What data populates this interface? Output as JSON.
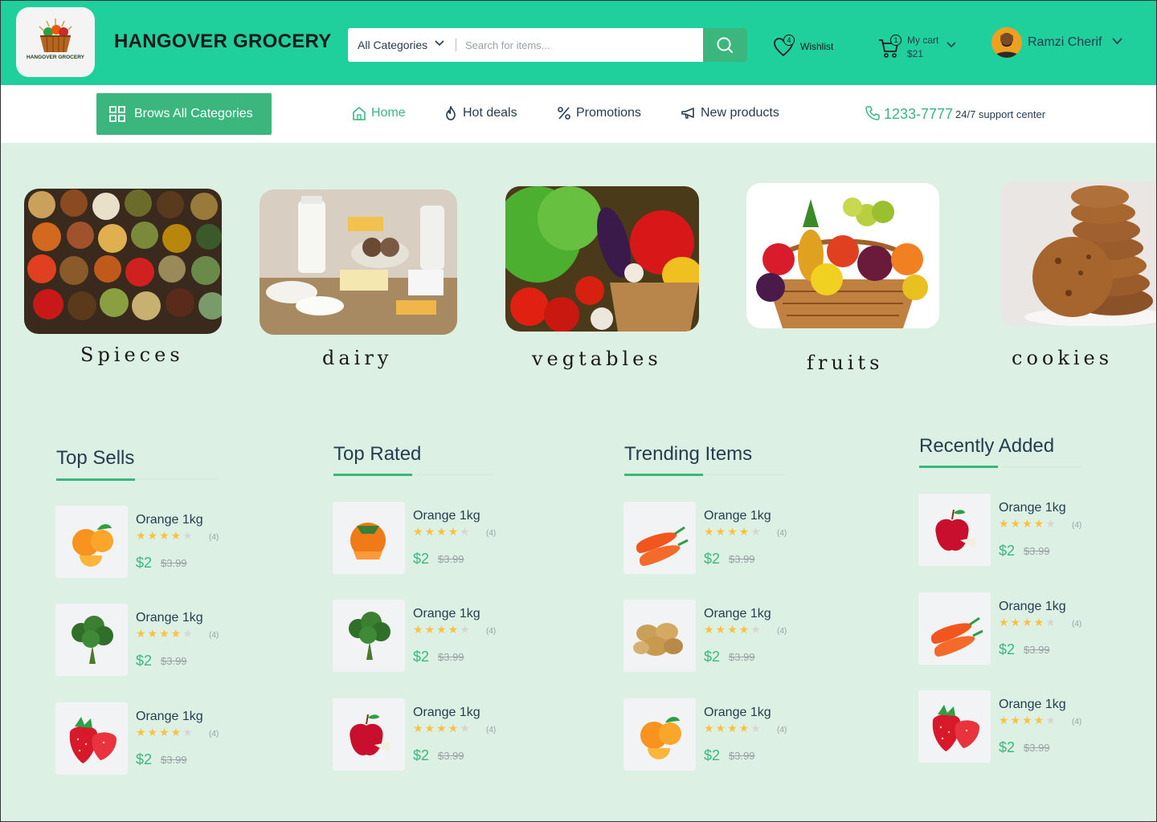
{
  "header": {
    "brand": "HANGOVER GROCERY",
    "logo_text": "HANGOVER GROCERY",
    "search": {
      "category": "All Categories",
      "placeholder": "Search for items..."
    },
    "wishlist": {
      "label": "Wishlist",
      "count": "4"
    },
    "cart": {
      "label": "My cart",
      "total": "$21",
      "count": "1"
    },
    "user": {
      "name": "Ramzi Cherif"
    }
  },
  "nav": {
    "browse_label": "Brows All Categories",
    "items": [
      "Home",
      "Hot deals",
      "Promotions",
      "New products"
    ],
    "phone": "1233-7777",
    "support": "24/7 support center"
  },
  "categories": [
    "Spieces",
    "dairy",
    "vegtables",
    "fruits",
    "cookies"
  ],
  "columns": [
    {
      "title": "Top Sells",
      "products": [
        {
          "image": "orange-icon",
          "name": "Orange 1kg",
          "rating": 4,
          "count": "(4)",
          "price": "$2",
          "old_price": "$3.99"
        },
        {
          "image": "broccoli-icon",
          "name": "Orange 1kg",
          "rating": 4,
          "count": "(4)",
          "price": "$2",
          "old_price": "$3.99"
        },
        {
          "image": "strawberry-icon",
          "name": "Orange 1kg",
          "rating": 4,
          "count": "(4)",
          "price": "$2",
          "old_price": "$3.99"
        }
      ]
    },
    {
      "title": "Top Rated",
      "products": [
        {
          "image": "persimmon-icon",
          "name": "Orange 1kg",
          "rating": 4,
          "count": "(4)",
          "price": "$2",
          "old_price": "$3.99"
        },
        {
          "image": "broccoli-icon",
          "name": "Orange 1kg",
          "rating": 4,
          "count": "(4)",
          "price": "$2",
          "old_price": "$3.99"
        },
        {
          "image": "apple-icon",
          "name": "Orange 1kg",
          "rating": 4,
          "count": "(4)",
          "price": "$2",
          "old_price": "$3.99"
        }
      ]
    },
    {
      "title": "Trending Items",
      "products": [
        {
          "image": "carrot-icon",
          "name": "Orange 1kg",
          "rating": 4,
          "count": "(4)",
          "price": "$2",
          "old_price": "$3.99"
        },
        {
          "image": "potato-icon",
          "name": "Orange 1kg",
          "rating": 4,
          "count": "(4)",
          "price": "$2",
          "old_price": "$3.99"
        },
        {
          "image": "orange-icon",
          "name": "Orange 1kg",
          "rating": 4,
          "count": "(4)",
          "price": "$2",
          "old_price": "$3.99"
        }
      ]
    },
    {
      "title": "Recently Added",
      "products": [
        {
          "image": "apple-icon",
          "name": "Orange 1kg",
          "rating": 4,
          "count": "(4)",
          "price": "$2",
          "old_price": "$3.99"
        },
        {
          "image": "carrot-icon",
          "name": "Orange 1kg",
          "rating": 4,
          "count": "(4)",
          "price": "$2",
          "old_price": "$3.99"
        },
        {
          "image": "strawberry-icon",
          "name": "Orange 1kg",
          "rating": 4,
          "count": "(4)",
          "price": "$2",
          "old_price": "$3.99"
        }
      ]
    }
  ],
  "colors": {
    "header": "#1fcf9c",
    "accent": "#3bb77e",
    "page": "#dcf1e3",
    "star": "#fdc040"
  }
}
